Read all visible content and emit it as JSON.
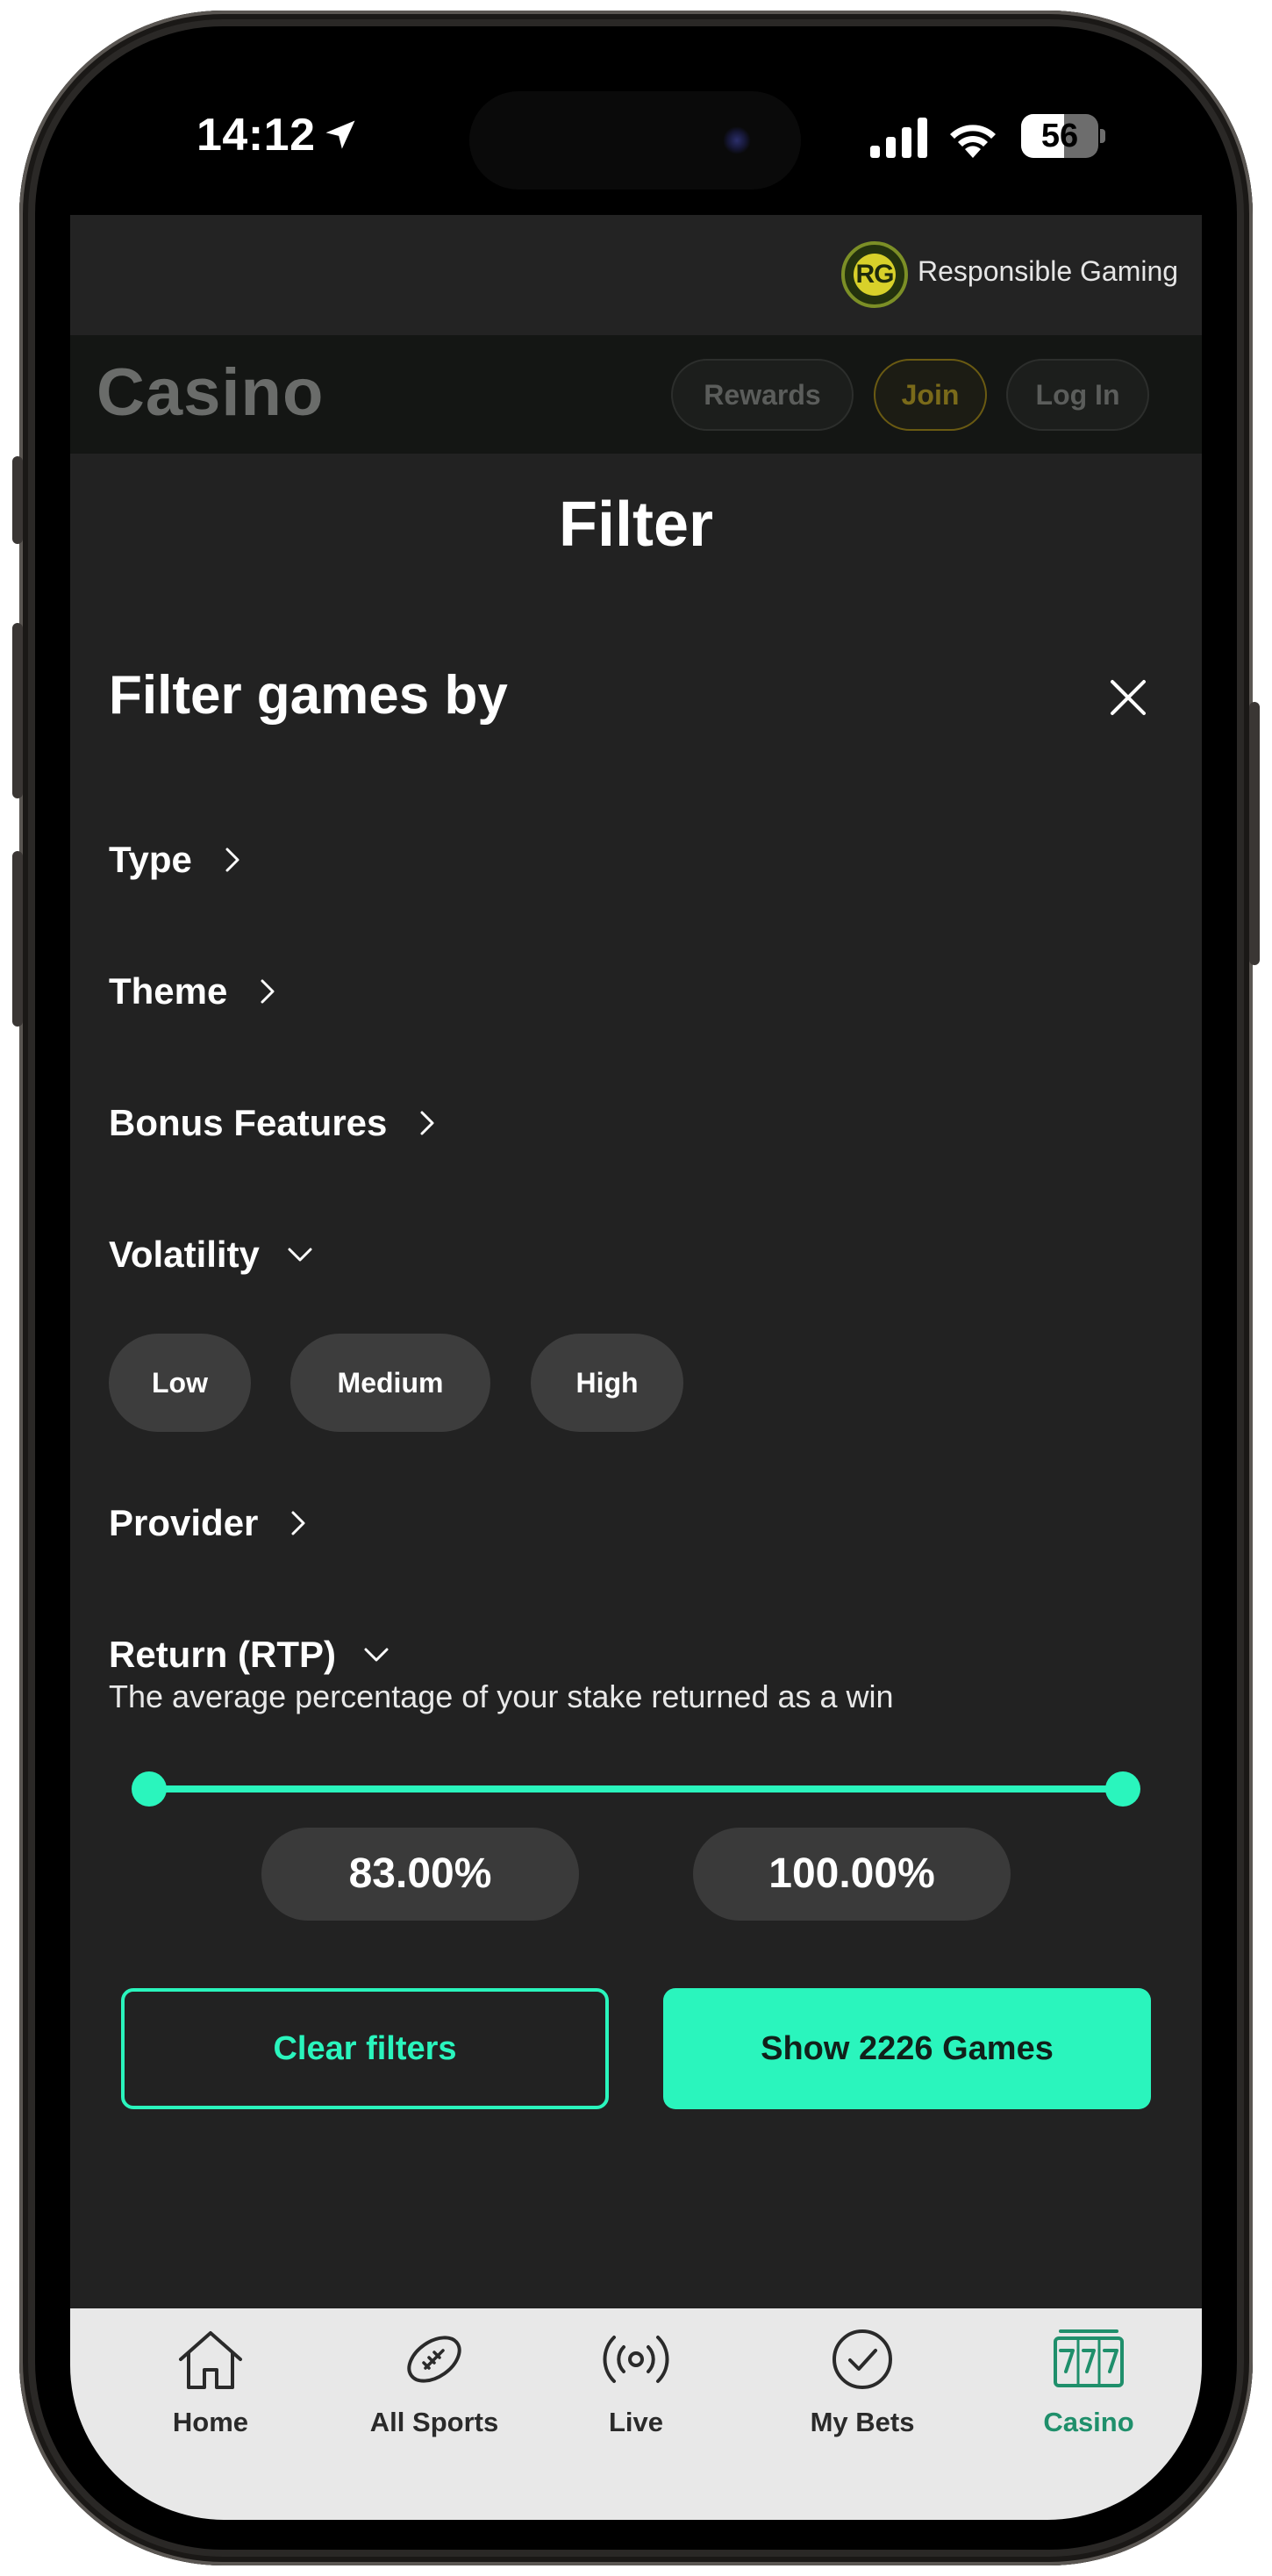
{
  "status_bar": {
    "time": "14:12",
    "battery": "56",
    "battery_level": 0.56
  },
  "rg_bar": {
    "logo_text": "RG",
    "label": "Responsible Gaming"
  },
  "header": {
    "brand": "Casino",
    "rewards": "Rewards",
    "join": "Join",
    "login": "Log In"
  },
  "sheet": {
    "title": "Filter",
    "heading": "Filter games by",
    "sections": {
      "type": "Type",
      "theme": "Theme",
      "bonus": "Bonus Features",
      "volatility": "Volatility",
      "provider": "Provider",
      "rtp": "Return (RTP)"
    },
    "volatility_options": [
      "Low",
      "Medium",
      "High"
    ],
    "rtp_description": "The average percentage of your stake returned as a win",
    "rtp_min": "83.00%",
    "rtp_max": "100.00%",
    "clear_label": "Clear filters",
    "show_label": "Show 2226 Games"
  },
  "bottom_nav": [
    "Home",
    "All Sports",
    "Live",
    "My Bets",
    "Casino"
  ],
  "colors": {
    "accent": "#2af5bd",
    "background": "#222222",
    "nav_bg": "#e8e8e8",
    "active_nav": "#1f8f6b"
  }
}
